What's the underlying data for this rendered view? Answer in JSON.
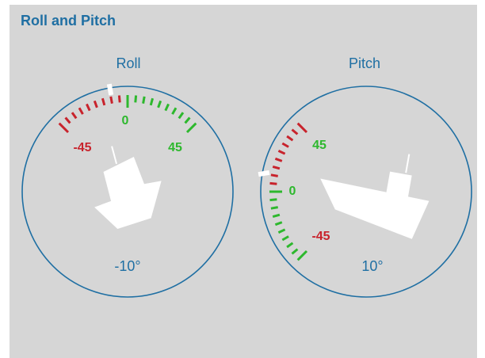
{
  "panel": {
    "title": "Roll and Pitch"
  },
  "roll": {
    "title": "Roll",
    "value": -10,
    "readout": "-10°",
    "labels": {
      "neg": "-45",
      "zero": "0",
      "pos": "45"
    },
    "colors": {
      "negative": "#c8232c",
      "positive": "#2db82d",
      "ring": "#1f6fa3",
      "indicator": "#ffffff"
    }
  },
  "pitch": {
    "title": "Pitch",
    "value": 10,
    "readout": "10°",
    "labels": {
      "pos": "45",
      "zero": "0",
      "neg": "-45"
    },
    "colors": {
      "negative": "#c8232c",
      "positive": "#2db82d",
      "ring": "#1f6fa3",
      "indicator": "#ffffff"
    }
  }
}
